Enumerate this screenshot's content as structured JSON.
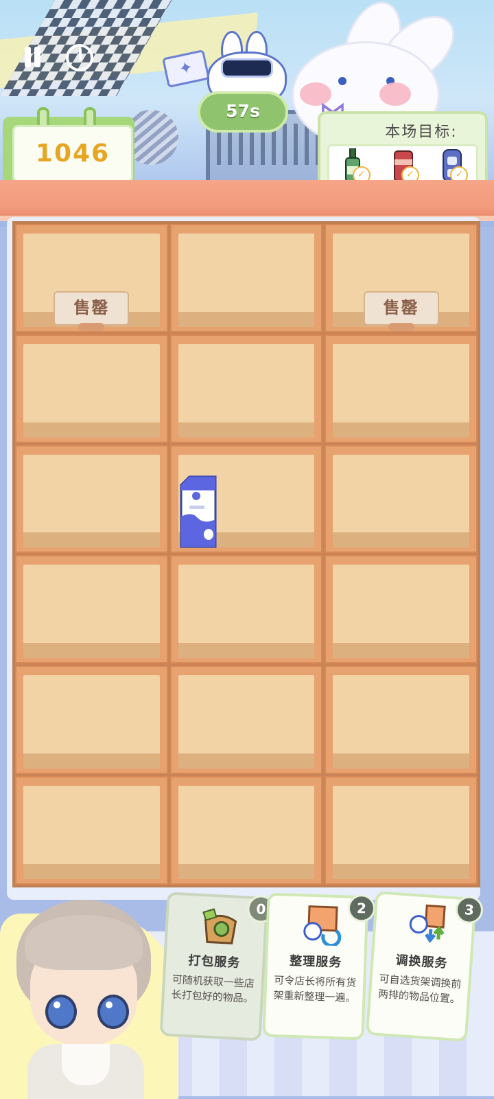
{
  "hud": {
    "score": "1046",
    "timer": "57s",
    "target_title": "本场目标:",
    "targets": [
      {
        "icon": "green-bottle-icon",
        "done": true
      },
      {
        "icon": "red-can-icon",
        "done": true
      },
      {
        "icon": "blue-cup-icon",
        "done": true
      }
    ]
  },
  "shelf": {
    "rows": 6,
    "cols": 3,
    "cells": [
      {
        "state": "soldout",
        "label": "售罄"
      },
      {
        "state": "empty"
      },
      {
        "state": "soldout",
        "label": "售罄"
      },
      {
        "state": "empty"
      },
      {
        "state": "empty"
      },
      {
        "state": "empty"
      },
      {
        "state": "empty"
      },
      {
        "state": "item",
        "item": "milk-carton-icon"
      },
      {
        "state": "empty"
      },
      {
        "state": "empty"
      },
      {
        "state": "empty"
      },
      {
        "state": "empty"
      },
      {
        "state": "empty"
      },
      {
        "state": "empty"
      },
      {
        "state": "empty"
      },
      {
        "state": "empty"
      },
      {
        "state": "empty"
      },
      {
        "state": "empty"
      }
    ]
  },
  "services": [
    {
      "name": "打包服务",
      "desc": "可随机获取一些店长打包好的物品。",
      "count": "0",
      "icon": "package-bag-icon"
    },
    {
      "name": "整理服务",
      "desc": "可令店长将所有货架重新整理一遍。",
      "count": "2",
      "icon": "shelf-refresh-icon"
    },
    {
      "name": "调换服务",
      "desc": "可自选货架调换前两排的物品位置。",
      "count": "3",
      "icon": "swap-arrows-icon"
    }
  ],
  "colors": {
    "score_text": "#e6a624",
    "timer_bg": "#8fc36e",
    "shelf_wood": "#e7a26f",
    "shelf_back": "#f2d3a6",
    "card_border": "#cfe8b4"
  }
}
